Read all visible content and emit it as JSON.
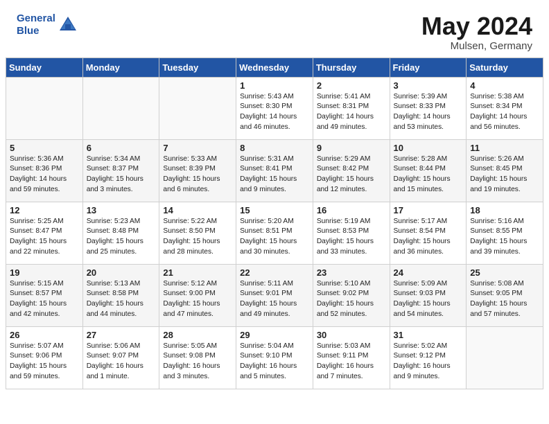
{
  "header": {
    "logo_line1": "General",
    "logo_line2": "Blue",
    "month_year": "May 2024",
    "location": "Mulsen, Germany"
  },
  "days_of_week": [
    "Sunday",
    "Monday",
    "Tuesday",
    "Wednesday",
    "Thursday",
    "Friday",
    "Saturday"
  ],
  "weeks": [
    [
      {
        "day": "",
        "content": ""
      },
      {
        "day": "",
        "content": ""
      },
      {
        "day": "",
        "content": ""
      },
      {
        "day": "1",
        "content": "Sunrise: 5:43 AM\nSunset: 8:30 PM\nDaylight: 14 hours\nand 46 minutes."
      },
      {
        "day": "2",
        "content": "Sunrise: 5:41 AM\nSunset: 8:31 PM\nDaylight: 14 hours\nand 49 minutes."
      },
      {
        "day": "3",
        "content": "Sunrise: 5:39 AM\nSunset: 8:33 PM\nDaylight: 14 hours\nand 53 minutes."
      },
      {
        "day": "4",
        "content": "Sunrise: 5:38 AM\nSunset: 8:34 PM\nDaylight: 14 hours\nand 56 minutes."
      }
    ],
    [
      {
        "day": "5",
        "content": "Sunrise: 5:36 AM\nSunset: 8:36 PM\nDaylight: 14 hours\nand 59 minutes."
      },
      {
        "day": "6",
        "content": "Sunrise: 5:34 AM\nSunset: 8:37 PM\nDaylight: 15 hours\nand 3 minutes."
      },
      {
        "day": "7",
        "content": "Sunrise: 5:33 AM\nSunset: 8:39 PM\nDaylight: 15 hours\nand 6 minutes."
      },
      {
        "day": "8",
        "content": "Sunrise: 5:31 AM\nSunset: 8:41 PM\nDaylight: 15 hours\nand 9 minutes."
      },
      {
        "day": "9",
        "content": "Sunrise: 5:29 AM\nSunset: 8:42 PM\nDaylight: 15 hours\nand 12 minutes."
      },
      {
        "day": "10",
        "content": "Sunrise: 5:28 AM\nSunset: 8:44 PM\nDaylight: 15 hours\nand 15 minutes."
      },
      {
        "day": "11",
        "content": "Sunrise: 5:26 AM\nSunset: 8:45 PM\nDaylight: 15 hours\nand 19 minutes."
      }
    ],
    [
      {
        "day": "12",
        "content": "Sunrise: 5:25 AM\nSunset: 8:47 PM\nDaylight: 15 hours\nand 22 minutes."
      },
      {
        "day": "13",
        "content": "Sunrise: 5:23 AM\nSunset: 8:48 PM\nDaylight: 15 hours\nand 25 minutes."
      },
      {
        "day": "14",
        "content": "Sunrise: 5:22 AM\nSunset: 8:50 PM\nDaylight: 15 hours\nand 28 minutes."
      },
      {
        "day": "15",
        "content": "Sunrise: 5:20 AM\nSunset: 8:51 PM\nDaylight: 15 hours\nand 30 minutes."
      },
      {
        "day": "16",
        "content": "Sunrise: 5:19 AM\nSunset: 8:53 PM\nDaylight: 15 hours\nand 33 minutes."
      },
      {
        "day": "17",
        "content": "Sunrise: 5:17 AM\nSunset: 8:54 PM\nDaylight: 15 hours\nand 36 minutes."
      },
      {
        "day": "18",
        "content": "Sunrise: 5:16 AM\nSunset: 8:55 PM\nDaylight: 15 hours\nand 39 minutes."
      }
    ],
    [
      {
        "day": "19",
        "content": "Sunrise: 5:15 AM\nSunset: 8:57 PM\nDaylight: 15 hours\nand 42 minutes."
      },
      {
        "day": "20",
        "content": "Sunrise: 5:13 AM\nSunset: 8:58 PM\nDaylight: 15 hours\nand 44 minutes."
      },
      {
        "day": "21",
        "content": "Sunrise: 5:12 AM\nSunset: 9:00 PM\nDaylight: 15 hours\nand 47 minutes."
      },
      {
        "day": "22",
        "content": "Sunrise: 5:11 AM\nSunset: 9:01 PM\nDaylight: 15 hours\nand 49 minutes."
      },
      {
        "day": "23",
        "content": "Sunrise: 5:10 AM\nSunset: 9:02 PM\nDaylight: 15 hours\nand 52 minutes."
      },
      {
        "day": "24",
        "content": "Sunrise: 5:09 AM\nSunset: 9:03 PM\nDaylight: 15 hours\nand 54 minutes."
      },
      {
        "day": "25",
        "content": "Sunrise: 5:08 AM\nSunset: 9:05 PM\nDaylight: 15 hours\nand 57 minutes."
      }
    ],
    [
      {
        "day": "26",
        "content": "Sunrise: 5:07 AM\nSunset: 9:06 PM\nDaylight: 15 hours\nand 59 minutes."
      },
      {
        "day": "27",
        "content": "Sunrise: 5:06 AM\nSunset: 9:07 PM\nDaylight: 16 hours\nand 1 minute."
      },
      {
        "day": "28",
        "content": "Sunrise: 5:05 AM\nSunset: 9:08 PM\nDaylight: 16 hours\nand 3 minutes."
      },
      {
        "day": "29",
        "content": "Sunrise: 5:04 AM\nSunset: 9:10 PM\nDaylight: 16 hours\nand 5 minutes."
      },
      {
        "day": "30",
        "content": "Sunrise: 5:03 AM\nSunset: 9:11 PM\nDaylight: 16 hours\nand 7 minutes."
      },
      {
        "day": "31",
        "content": "Sunrise: 5:02 AM\nSunset: 9:12 PM\nDaylight: 16 hours\nand 9 minutes."
      },
      {
        "day": "",
        "content": ""
      }
    ]
  ]
}
